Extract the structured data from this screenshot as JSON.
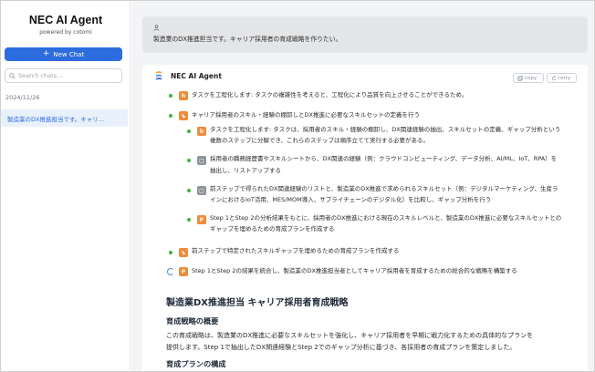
{
  "sidebar": {
    "app_title": "NEC AI Agent",
    "powered_by": "powered by cotomi",
    "new_chat_label": "New Chat",
    "search_placeholder": "Search chats...",
    "date_group": "2024/11/26",
    "history": [
      {
        "label": "製造業のDX推進担当です。キャリ..."
      }
    ]
  },
  "user_message": {
    "text": "製造業のDX推進担当です。キャリア採用者の育成戦略を作りたい。"
  },
  "agent": {
    "name": "NEC AI Agent",
    "copy_label": "copy",
    "retry_label": "retry",
    "steps": [
      {
        "text": "タスクを工程化します: タスクの複雑性を考えると、工程化により品質を向上させることができるため。"
      },
      {
        "text": "キャリア採用者のスキル・経験の棚卸しとDX推進に必要なスキルセットの定義を行う"
      },
      {
        "line1": "タスクを工程化します: タスクは、採用者のスキル・経験の棚卸し、DX関連経験の抽出、スキルセットの定義、ギャップ分析という",
        "line2": "複数のステップに分解でき、これらのステップは順序立てて実行する必要がある。"
      },
      {
        "line1": "採用者の職務経歴書やスキルシートから、DX関連の経験（例：クラウドコンピューティング、データ分析、AI/ML、IoT、RPA）を",
        "line2": "抽出し、リストアップする"
      },
      {
        "line1": "前ステップで得られたDX関連経験のリストと、製造業のDX推進で求められるスキルセット（例：デジタルマーケティング、生産ラ",
        "line2": "インにおけるIoT活用、MES/MOM導入、サプライチェーンのデジタル化）を比較し、ギャップ分析を行う"
      },
      {
        "line1": "Step 1とStep 2の分析結果をもとに、採用者のDX推進における現在のスキルレベルと、製造業のDX推進に必要なスキルセットとの",
        "line2": "ギャップを埋めるための育成プランを作成する"
      },
      {
        "text": "前ステップで特定されたスキルギャップを埋めるための育成プランを作成する"
      },
      {
        "text": "Step 1とStep 2の結果を統合し、製造業のDX推進担当者としてキャリア採用者を育成するための総合的な戦略を構築する"
      }
    ],
    "report": {
      "title": "製造業DX推進担当 キャリア採用者育成戦略",
      "section1": "育成戦略の概要",
      "para_line1": "この育成戦略は、製造業のDX推進に必要なスキルセットを強化し、キャリア採用者を早期に戦力化するための具体的なプランを",
      "para_line2": "提供します。Step 1で抽出したDX関連経験とStep 2でのギャップ分析に基づき、各採用者の育成プランを策定しました。",
      "section2": "育成プランの構成"
    }
  },
  "colors": {
    "accent": "#2d6cdf",
    "step_dot": "#3fb43f",
    "tag_orange": "#f08b3a",
    "tag_gray": "#8e959c"
  }
}
